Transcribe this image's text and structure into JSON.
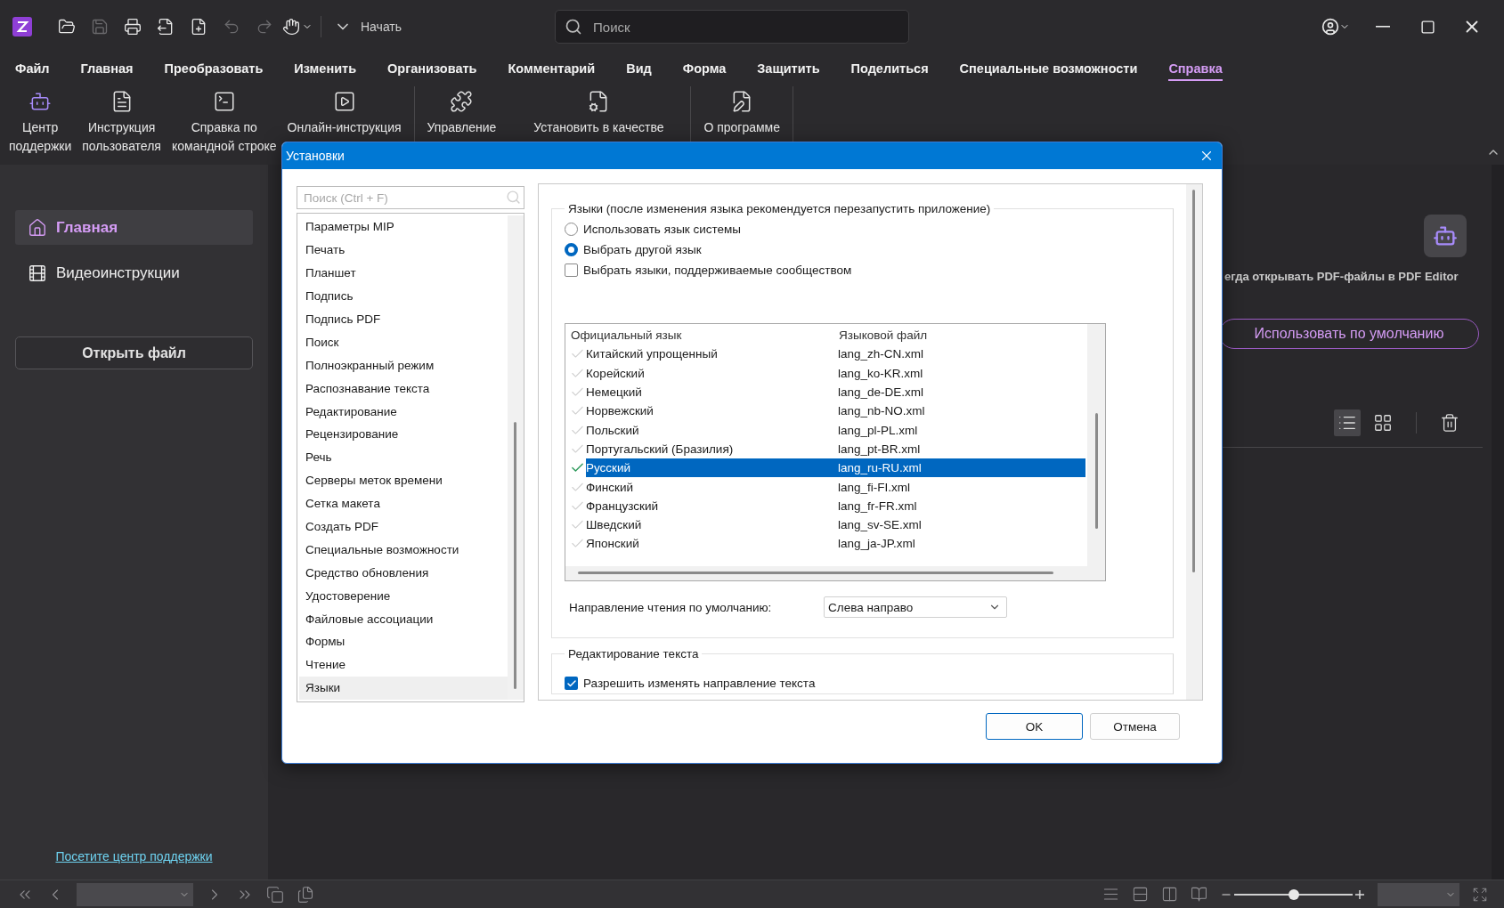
{
  "title_bar": {
    "quick_tools": [
      {
        "kind": "open",
        "disabled": false
      },
      {
        "kind": "save",
        "disabled": true
      },
      {
        "kind": "print",
        "disabled": false
      },
      {
        "kind": "export",
        "disabled": false
      },
      {
        "kind": "new",
        "disabled": false
      },
      {
        "kind": "undo",
        "disabled": true
      },
      {
        "kind": "redo",
        "disabled": true
      },
      {
        "kind": "hand",
        "disabled": false
      }
    ],
    "start_button": "Начать",
    "search": {
      "placeholder": "Поиск"
    }
  },
  "menu": [
    {
      "label": "Файл",
      "selected": false
    },
    {
      "label": "Главная",
      "selected": false
    },
    {
      "label": "Преобразовать",
      "selected": false
    },
    {
      "label": "Изменить",
      "selected": false
    },
    {
      "label": "Организовать",
      "selected": false
    },
    {
      "label": "Комментарий",
      "selected": false
    },
    {
      "label": "Вид",
      "selected": false
    },
    {
      "label": "Форма",
      "selected": false
    },
    {
      "label": "Защитить",
      "selected": false
    },
    {
      "label": "Поделиться",
      "selected": false
    },
    {
      "label": "Специальные возможности",
      "selected": false
    },
    {
      "label": "Справка",
      "selected": true
    }
  ],
  "ribbon": {
    "groups": [
      [
        {
          "kind": "robot",
          "lines": [
            "Центр",
            "поддержки"
          ]
        },
        {
          "kind": "manual",
          "lines": [
            "Инструкция",
            "пользователя"
          ]
        },
        {
          "kind": "terminal",
          "lines": [
            "Справка по",
            "командной строке"
          ]
        },
        {
          "kind": "video",
          "lines": [
            "Онлайн-инструкция"
          ]
        }
      ],
      [
        {
          "kind": "puzzle",
          "lines": [
            "Управление"
          ]
        },
        {
          "kind": "file-gear",
          "lines": [
            "Установить в качестве"
          ]
        }
      ],
      [
        {
          "kind": "file-pen",
          "lines": [
            "О программе"
          ]
        }
      ]
    ]
  },
  "sidebar": {
    "items": [
      {
        "kind": "home",
        "label": "Главная",
        "selected": true
      },
      {
        "kind": "film",
        "label": "Видеоинструкции",
        "selected": false
      }
    ],
    "open_button": "Открыть файл",
    "support_link": "Посетите центр поддержки"
  },
  "main": {
    "banner_text": "егда открывать PDF-файлы в PDF Editor",
    "default_button": "Использовать по умолчанию",
    "views": [
      {
        "kind": "list",
        "selected": true
      },
      {
        "kind": "grid",
        "selected": false
      }
    ]
  },
  "status_bar": {
    "zoom": {
      "level": 0.5
    }
  },
  "dialog": {
    "title": "Установки",
    "search": {
      "placeholder": "Поиск (Ctrl + F)"
    },
    "categories": [
      {
        "label": "Параметры MIP",
        "selected": false
      },
      {
        "label": "Печать",
        "selected": false
      },
      {
        "label": "Планшет",
        "selected": false
      },
      {
        "label": "Подпись",
        "selected": false
      },
      {
        "label": "Подпись PDF",
        "selected": false
      },
      {
        "label": "Поиск",
        "selected": false
      },
      {
        "label": "Полноэкранный режим",
        "selected": false
      },
      {
        "label": "Распознавание текста",
        "selected": false
      },
      {
        "label": "Редактирование",
        "selected": false
      },
      {
        "label": "Рецензирование",
        "selected": false
      },
      {
        "label": "Речь",
        "selected": false
      },
      {
        "label": "Серверы меток времени",
        "selected": false
      },
      {
        "label": "Сетка макета",
        "selected": false
      },
      {
        "label": "Создать PDF",
        "selected": false
      },
      {
        "label": "Специальные возможности",
        "selected": false
      },
      {
        "label": "Средство обновления",
        "selected": false
      },
      {
        "label": "Удостоверение",
        "selected": false
      },
      {
        "label": "Файловые ассоциации",
        "selected": false
      },
      {
        "label": "Формы",
        "selected": false
      },
      {
        "label": "Чтение",
        "selected": false
      },
      {
        "label": "Языки",
        "selected": true
      }
    ],
    "languages_group": {
      "title": "Языки (после изменения языка рекомендуется перезапустить приложение)",
      "options": [
        {
          "kind": "radio",
          "label": "Использовать язык системы",
          "checked": false
        },
        {
          "kind": "radio",
          "label": "Выбрать другой язык",
          "checked": true
        },
        {
          "kind": "checkbox",
          "label": "Выбрать языки, поддерживаемые сообществом",
          "checked": false
        }
      ],
      "table": {
        "columns": [
          "Официальный язык",
          "Языковой файл"
        ],
        "rows": [
          {
            "language": "Китайский упрощенный",
            "file": "lang_zh-CN.xml",
            "current": false,
            "selected": false
          },
          {
            "language": "Корейский",
            "file": "lang_ko-KR.xml",
            "current": false,
            "selected": false
          },
          {
            "language": "Немецкий",
            "file": "lang_de-DE.xml",
            "current": false,
            "selected": false
          },
          {
            "language": "Норвежский",
            "file": "lang_nb-NO.xml",
            "current": false,
            "selected": false
          },
          {
            "language": "Польский",
            "file": "lang_pl-PL.xml",
            "current": false,
            "selected": false
          },
          {
            "language": "Португальский (Бразилия)",
            "file": "lang_pt-BR.xml",
            "current": false,
            "selected": false
          },
          {
            "language": "Русский",
            "file": "lang_ru-RU.xml",
            "current": true,
            "selected": true
          },
          {
            "language": "Финский",
            "file": "lang_fi-FI.xml",
            "current": false,
            "selected": false
          },
          {
            "language": "Французский",
            "file": "lang_fr-FR.xml",
            "current": false,
            "selected": false
          },
          {
            "language": "Шведский",
            "file": "lang_sv-SE.xml",
            "current": false,
            "selected": false
          },
          {
            "language": "Японский",
            "file": "lang_ja-JP.xml",
            "current": false,
            "selected": false
          }
        ]
      },
      "direction": {
        "label": "Направление чтения по умолчанию:",
        "value": "Слева направо"
      }
    },
    "editing_group": {
      "title": "Редактирование текста",
      "option": {
        "label": "Разрешить изменять направление текста",
        "checked": true
      }
    },
    "buttons": [
      {
        "kind": "default",
        "label": "OK"
      },
      {
        "kind": "normal",
        "label": "Отмена"
      }
    ]
  }
}
